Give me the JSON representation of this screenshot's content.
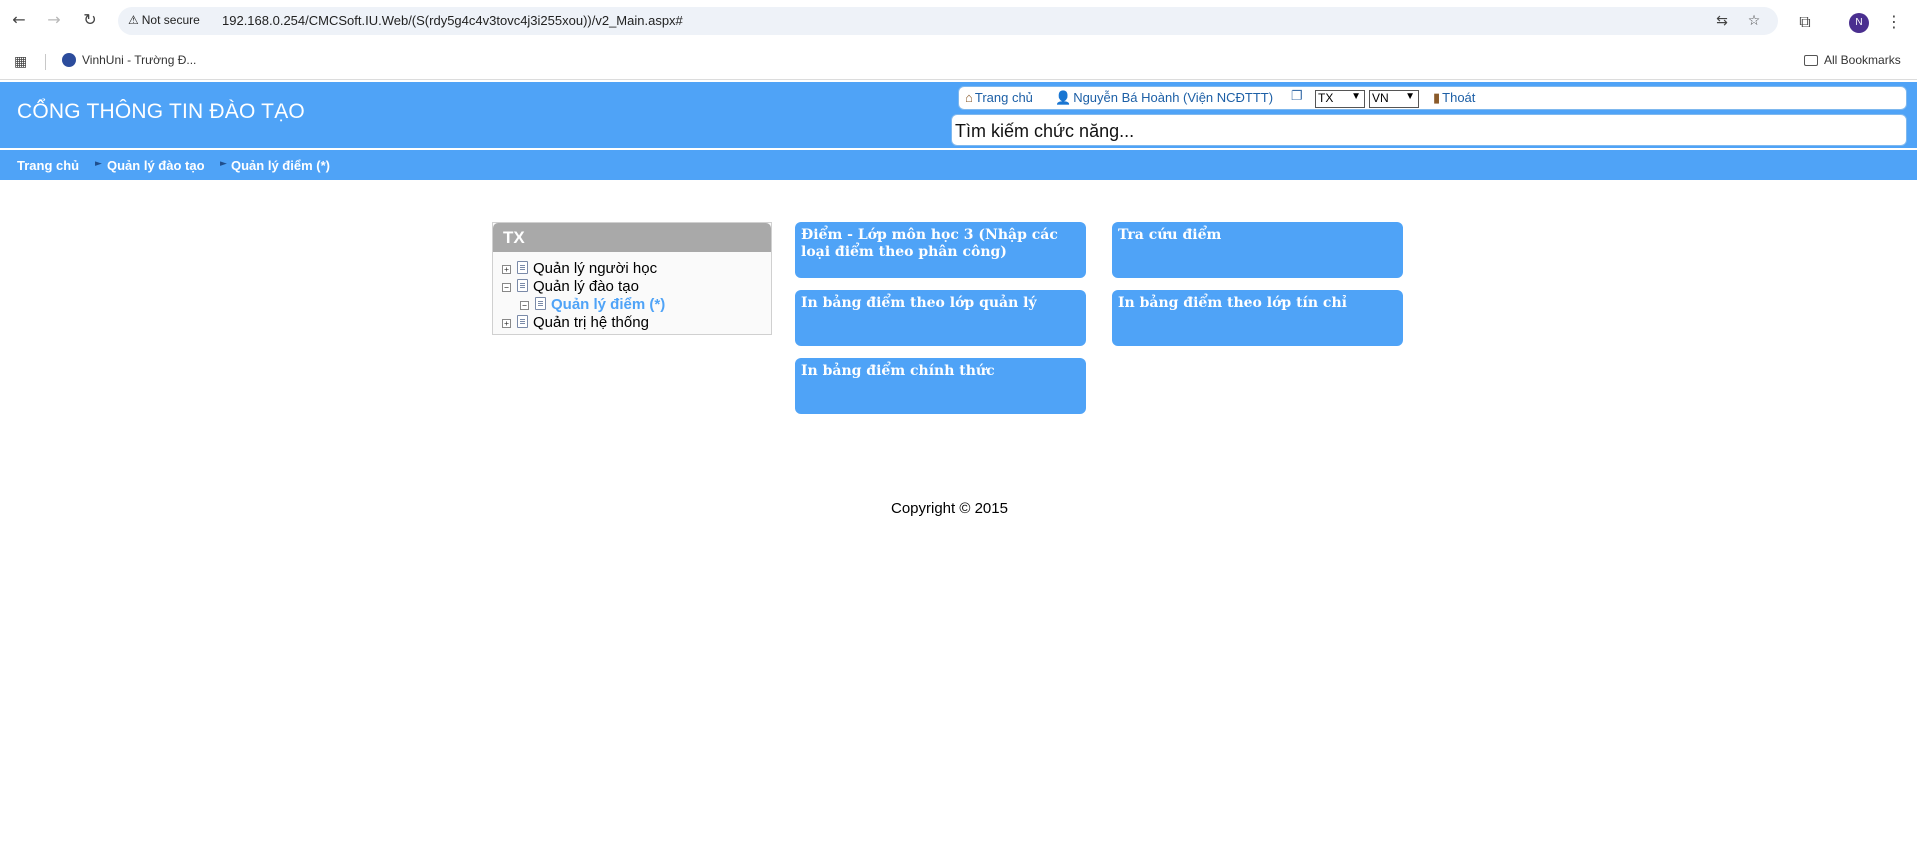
{
  "browser": {
    "security_label": "Not secure",
    "url": "192.168.0.254/CMCSoft.IU.Web/(S(rdy5g4c4v3tovc4j3i255xou))/v2_Main.aspx#",
    "avatar_letter": "N",
    "bookmarks": [
      {
        "label": "VinhUni - Trường Đ..."
      }
    ],
    "all_bookmarks_label": "All Bookmarks"
  },
  "header": {
    "site_title": "CỔNG THÔNG TIN ĐÀO TẠO",
    "links": {
      "home": "Trang chủ",
      "user": "Nguyễn Bá Hoành (Viện NCĐTTT)",
      "logout": "Thoát"
    },
    "selects": {
      "mode_value": "TX",
      "lang_value": "VN"
    },
    "search_placeholder": "Tìm kiếm chức năng..."
  },
  "breadcrumb": [
    "Trang chủ",
    "Quản lý đào tạo",
    "Quản lý điểm (*)"
  ],
  "tree": {
    "title": "TX",
    "items": [
      {
        "label": "Quản lý người học",
        "toggle": "+",
        "active": false
      },
      {
        "label": "Quản lý đào tạo",
        "toggle": "−",
        "active": false
      },
      {
        "label": "Quản lý điểm (*)",
        "toggle": "−",
        "active": true
      },
      {
        "label": "Quản trị hệ thống",
        "toggle": "+",
        "active": false
      }
    ]
  },
  "tiles": [
    "Điểm - Lớp môn học 3 (Nhập các loại điểm theo phân công)",
    "Tra cứu điểm",
    "In bảng điểm theo lớp quản lý",
    "In bảng điểm theo lớp tín chỉ",
    "In bảng điểm chính thức"
  ],
  "footer": {
    "copyright": "Copyright © 2015"
  },
  "colors": {
    "brand_blue": "#4fa3f7",
    "tree_header_gray": "#a9a9a9",
    "link_blue": "#1c5fa6"
  },
  "icons": [
    "back-arrow-icon",
    "forward-arrow-icon",
    "reload-icon",
    "warning-icon",
    "translate-icon",
    "star-icon",
    "extensions-icon",
    "apps-grid-icon",
    "folder-icon",
    "home-icon",
    "user-icon",
    "window-icon",
    "logout-icon"
  ]
}
